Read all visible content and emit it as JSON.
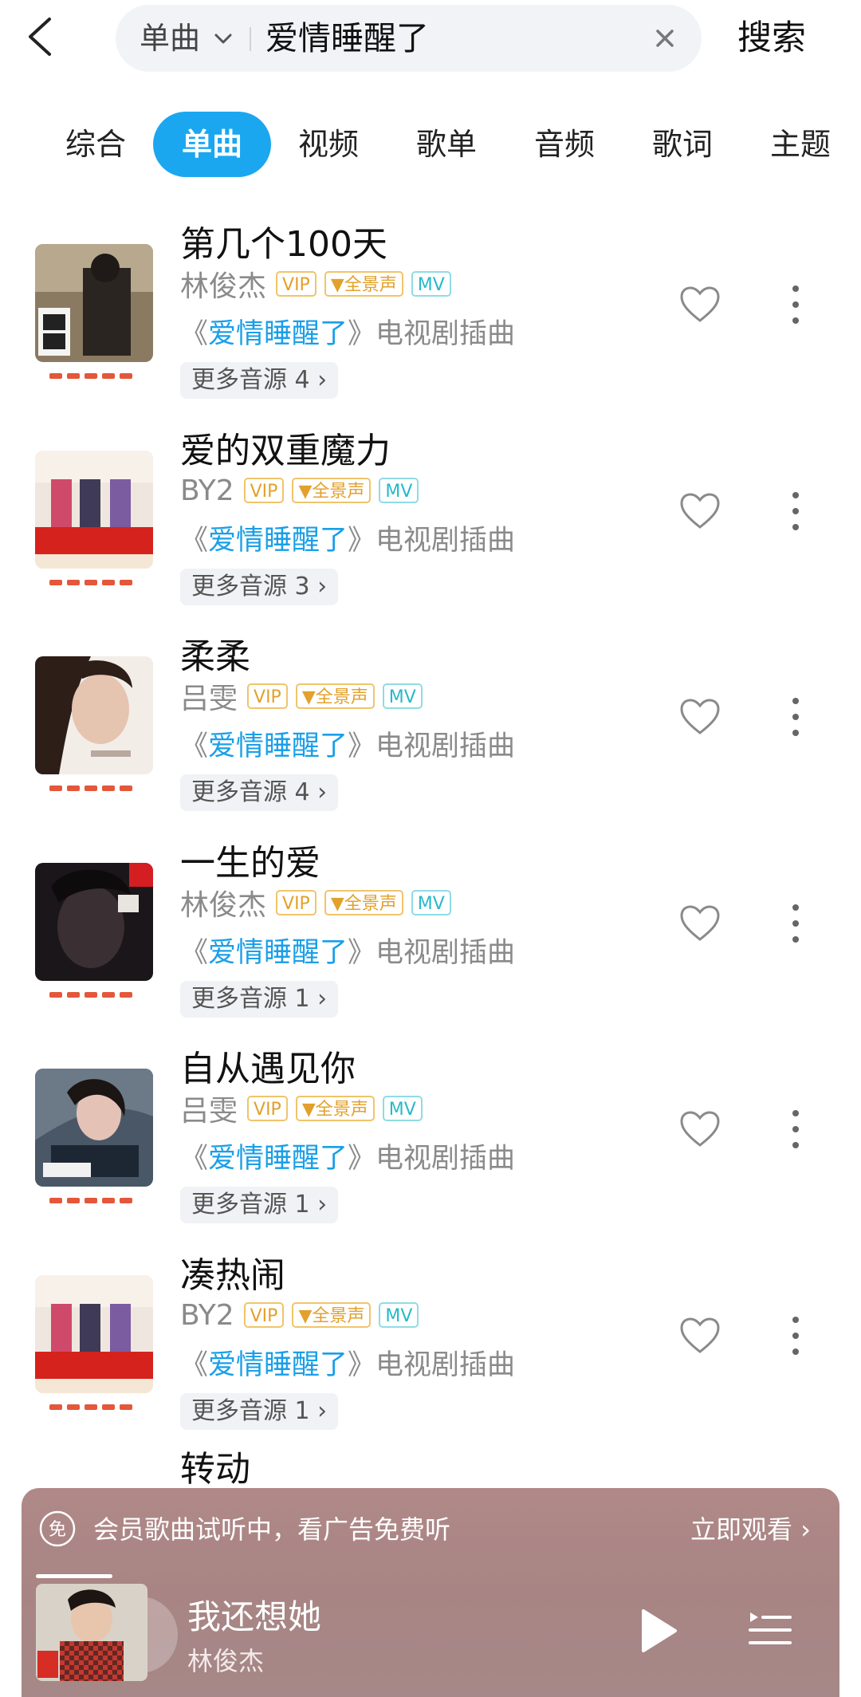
{
  "search": {
    "type_label": "单曲",
    "query": "爱情睡醒了",
    "submit_label": "搜索"
  },
  "tabs": [
    {
      "label": "综合",
      "active": false
    },
    {
      "label": "单曲",
      "active": true
    },
    {
      "label": "视频",
      "active": false
    },
    {
      "label": "歌单",
      "active": false
    },
    {
      "label": "音频",
      "active": false
    },
    {
      "label": "歌词",
      "active": false
    },
    {
      "label": "主题",
      "active": false
    }
  ],
  "badges": {
    "vip": "VIP",
    "hifi": "全景声",
    "mv": "MV"
  },
  "songs": [
    {
      "title": "第几个100天",
      "artist": "林俊杰",
      "album_prefix": "《",
      "album": "爱情睡醒了",
      "album_suffix": "》电视剧插曲",
      "more_sources": "更多音源 4"
    },
    {
      "title": "爱的双重魔力",
      "artist": "BY2",
      "album_prefix": "《",
      "album": "爱情睡醒了",
      "album_suffix": "》电视剧插曲",
      "more_sources": "更多音源 3"
    },
    {
      "title": "柔柔",
      "artist": "吕雯",
      "album_prefix": "《",
      "album": "爱情睡醒了",
      "album_suffix": "》电视剧插曲",
      "more_sources": "更多音源 4"
    },
    {
      "title": "一生的爱",
      "artist": "林俊杰",
      "album_prefix": "《",
      "album": "爱情睡醒了",
      "album_suffix": "》电视剧插曲",
      "more_sources": "更多音源 1"
    },
    {
      "title": "自从遇见你",
      "artist": "吕雯",
      "album_prefix": "《",
      "album": "爱情睡醒了",
      "album_suffix": "》电视剧插曲",
      "more_sources": "更多音源 1"
    },
    {
      "title": "凑热闹",
      "artist": "BY2",
      "album_prefix": "《",
      "album": "爱情睡醒了",
      "album_suffix": "》电视剧插曲",
      "more_sources": "更多音源 1"
    }
  ],
  "peek_song_title": "转动",
  "ad": {
    "icon_glyph": "免",
    "text": "会员歌曲试听中，看广告免费听",
    "cta": "立即观看"
  },
  "now_playing": {
    "title": "我还想她",
    "artist": "林俊杰"
  },
  "colors": {
    "accent": "#1ba7f0",
    "album_link": "#1a9fe8",
    "player_bg": "#a98685"
  }
}
